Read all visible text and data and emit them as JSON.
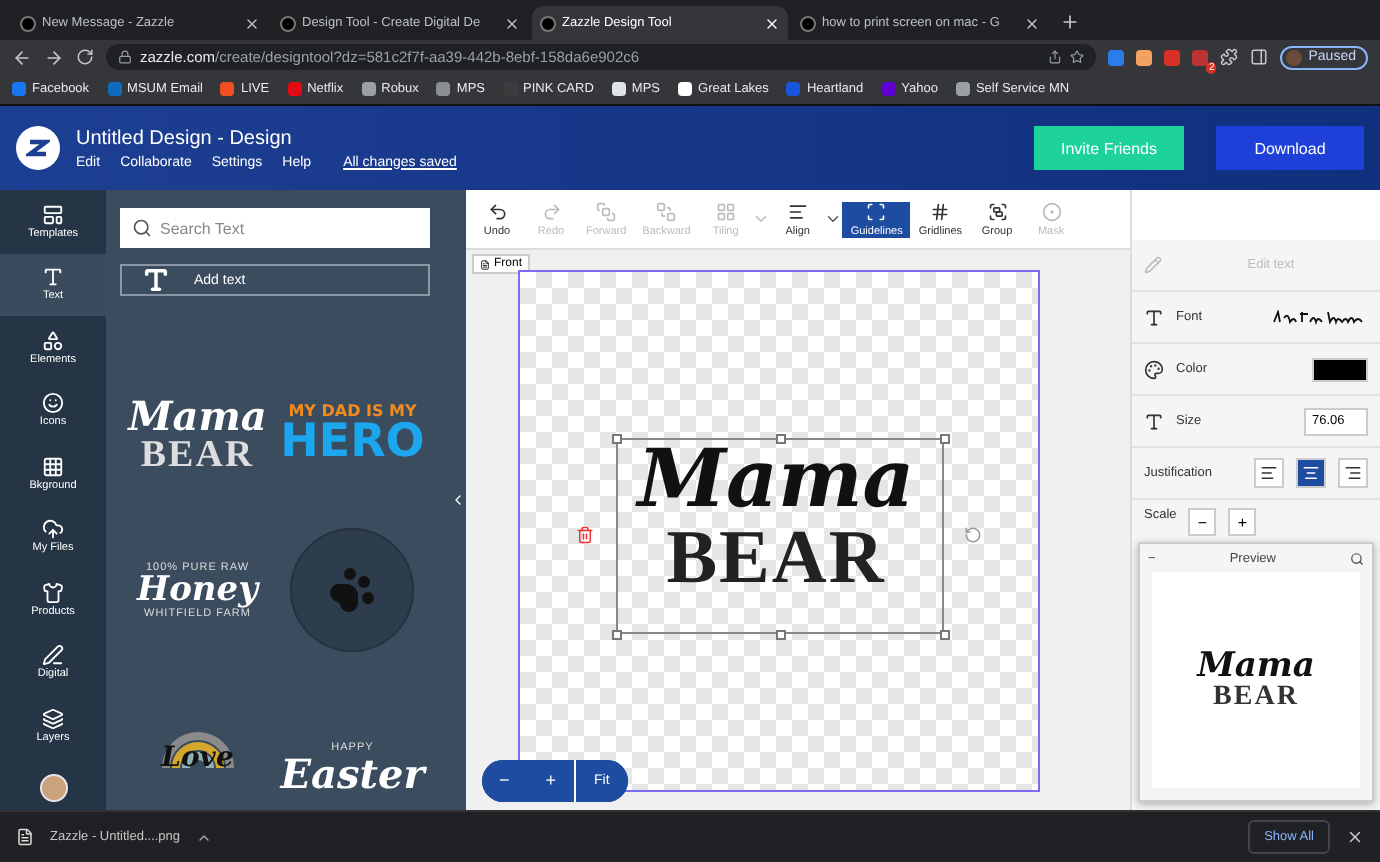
{
  "browser": {
    "tabs": [
      {
        "title": "New Message - Zazzle",
        "selected": false
      },
      {
        "title": "Design Tool - Create Digital De",
        "selected": false
      },
      {
        "title": "Zazzle Design Tool",
        "selected": true
      },
      {
        "title": "how to print screen on mac - G",
        "selected": false
      }
    ],
    "url_host": "zazzle.com",
    "url_path": "/create/designtool?dz=581c2f7f-aa39-442b-8ebf-158da6e902c6",
    "extension_badge": "2",
    "profile_status": "Paused",
    "bookmarks": [
      {
        "label": "Facebook",
        "color": "#1877f2"
      },
      {
        "label": "MSUM Email",
        "color": "#0f6cbd"
      },
      {
        "label": "LIVE",
        "color": "#f25022"
      },
      {
        "label": "Netflix",
        "color": "#e50914"
      },
      {
        "label": "Robux",
        "color": "#9aa0a6"
      },
      {
        "label": "MPS",
        "color": "#8a8f96"
      },
      {
        "label": "PINK CARD",
        "color": "#3c3c3c"
      },
      {
        "label": "MPS",
        "color": "#dfe3ea"
      },
      {
        "label": "Great Lakes",
        "color": "#ffffff"
      },
      {
        "label": "Heartland",
        "color": "#1a56db"
      },
      {
        "label": "Yahoo",
        "color": "#6001d2"
      },
      {
        "label": "Self Service MN",
        "color": "#9aa0a6"
      }
    ]
  },
  "app": {
    "title": "Untitled Design - Design",
    "menu": [
      "Edit",
      "Collaborate",
      "Settings",
      "Help"
    ],
    "status": "All changes saved",
    "invite": "Invite Friends",
    "download": "Download"
  },
  "rail": [
    {
      "label": "Templates",
      "kind": "templates",
      "selected": false
    },
    {
      "label": "Text",
      "kind": "text",
      "selected": true
    },
    {
      "label": "Elements",
      "kind": "elements",
      "selected": false
    },
    {
      "label": "Icons",
      "kind": "icons",
      "selected": false
    },
    {
      "label": "Bkground",
      "kind": "background",
      "selected": false
    },
    {
      "label": "My Files",
      "kind": "files",
      "selected": false
    },
    {
      "label": "Products",
      "kind": "products",
      "selected": false
    },
    {
      "label": "Digital",
      "kind": "digital",
      "selected": false
    },
    {
      "label": "Layers",
      "kind": "layers",
      "selected": false
    }
  ],
  "panel": {
    "search_placeholder": "Search Text",
    "add_text": "Add text",
    "templates": [
      {
        "kind": "mama_bear",
        "lines": [
          "Mama",
          "BEAR"
        ]
      },
      {
        "kind": "hero",
        "lines": [
          "MY DAD IS MY",
          "HERO"
        ]
      },
      {
        "kind": "honey",
        "lines": [
          "100% PURE RAW",
          "Honey",
          "WHITFIELD FARM"
        ]
      },
      {
        "kind": "stamp"
      },
      {
        "kind": "rainbow",
        "lines": [
          "Love"
        ]
      },
      {
        "kind": "easter",
        "lines": [
          "HAPPY",
          "Easter"
        ]
      }
    ]
  },
  "toolbar": [
    {
      "label": "Undo",
      "kind": "undo",
      "disabled": false,
      "selected": false,
      "dropdown": false
    },
    {
      "label": "Redo",
      "kind": "redo",
      "disabled": true,
      "selected": false,
      "dropdown": false
    },
    {
      "label": "Forward",
      "kind": "forward",
      "disabled": true,
      "selected": false,
      "dropdown": false
    },
    {
      "label": "Backward",
      "kind": "backward",
      "disabled": true,
      "selected": false,
      "dropdown": false
    },
    {
      "label": "Tiling",
      "kind": "tiling",
      "disabled": true,
      "selected": false,
      "dropdown": true
    },
    {
      "label": "Align",
      "kind": "align",
      "disabled": false,
      "selected": false,
      "dropdown": true
    },
    {
      "label": "Guidelines",
      "kind": "guidelines",
      "disabled": false,
      "selected": true,
      "dropdown": false
    },
    {
      "label": "Gridlines",
      "kind": "gridlines",
      "disabled": false,
      "selected": false,
      "dropdown": false
    },
    {
      "label": "Group",
      "kind": "group",
      "disabled": false,
      "selected": false,
      "dropdown": false
    },
    {
      "label": "Mask",
      "kind": "mask",
      "disabled": true,
      "selected": false,
      "dropdown": false
    }
  ],
  "canvas": {
    "side": "Front",
    "lines": [
      "Mama",
      "BEAR"
    ],
    "zoom_out": "−",
    "zoom_in": "+",
    "fit": "Fit"
  },
  "props": {
    "edit_text": {
      "label": "Edit text",
      "disabled": true
    },
    "font": {
      "label": "Font"
    },
    "color": {
      "label": "Color",
      "color": "#000000"
    },
    "size": {
      "label": "Size",
      "value": "76.06"
    },
    "justification": {
      "label": "Justification",
      "options": [
        {
          "kind": "left",
          "selected": false
        },
        {
          "kind": "center",
          "selected": true
        },
        {
          "kind": "right",
          "selected": false
        }
      ]
    },
    "scale": {
      "label": "Scale",
      "minus": "−",
      "plus": "+"
    },
    "preview": {
      "minimize": "−",
      "title": "Preview",
      "lines": [
        "Mama",
        "BEAR"
      ]
    }
  },
  "downloads": {
    "file": "Zazzle - Untitled....png",
    "show_all": "Show All"
  }
}
